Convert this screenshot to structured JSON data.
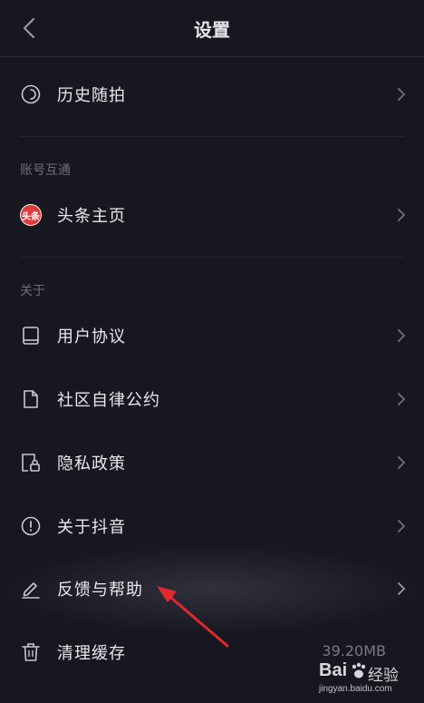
{
  "header": {
    "title": "设置",
    "back_icon": "chevron-left-icon"
  },
  "rows": {
    "history": {
      "label": "历史随拍",
      "icon": "history-circle-icon"
    },
    "toutiao": {
      "label": "头条主页",
      "badge": "头条"
    },
    "agreement": {
      "label": "用户协议",
      "icon": "book-icon"
    },
    "community": {
      "label": "社区自律公约",
      "icon": "document-icon"
    },
    "privacy": {
      "label": "隐私政策",
      "icon": "privacy-lock-icon"
    },
    "about_douyin": {
      "label": "关于抖音",
      "icon": "info-circle-icon"
    },
    "feedback": {
      "label": "反馈与帮助",
      "icon": "pencil-icon"
    },
    "clear_cache": {
      "label": "清理缓存",
      "icon": "trash-icon",
      "value": "39.20MB"
    }
  },
  "sections": {
    "account_link": "账号互通",
    "about": "关于"
  },
  "watermark": {
    "brand": "Bai",
    "jingyan": "经验",
    "url": "jingyan.baidu.com"
  },
  "colors": {
    "background": "#17171f",
    "text": "#e8e8ec",
    "muted": "#6f6f78",
    "arrow": "#e0282e"
  }
}
